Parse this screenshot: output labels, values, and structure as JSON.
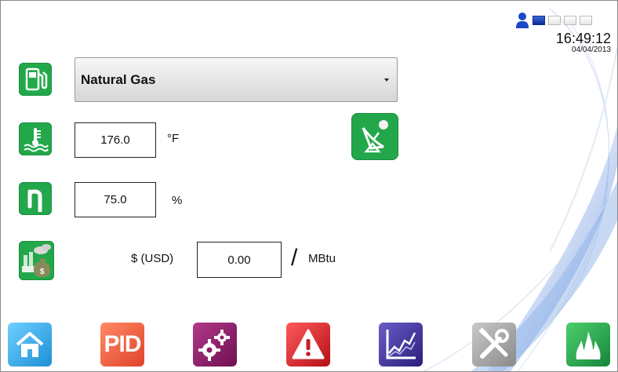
{
  "status": {
    "user_icon": "user-icon",
    "access_levels": [
      true,
      false,
      false,
      false
    ],
    "time": "16:49:12",
    "date": "04/04/2013"
  },
  "fuel": {
    "icon": "fuel-pump-icon",
    "selected": "Natural Gas"
  },
  "temperature": {
    "icon": "thermometer-water-icon",
    "value": "176.0",
    "unit": "°F"
  },
  "efficiency": {
    "icon": "eta-efficiency-icon",
    "value": "75.0",
    "unit": "%"
  },
  "cost": {
    "icon": "fuel-cost-icon",
    "currency_label": "$ (USD)",
    "value": "0.00",
    "separator": "/",
    "unit": "MBtu"
  },
  "remote_icon": "satellite-dish-icon",
  "nav": [
    {
      "icon": "home-icon",
      "color": "#29a3e0"
    },
    {
      "icon": "pid-icon",
      "label": "PID",
      "color": "#e8553a"
    },
    {
      "icon": "settings-gears-icon",
      "color": "#8e1a6a"
    },
    {
      "icon": "alarm-warning-icon",
      "color": "#c81e24"
    },
    {
      "icon": "trend-chart-icon",
      "color": "#3b2f8f"
    },
    {
      "icon": "tools-icon",
      "color": "#9a9a9a"
    },
    {
      "icon": "flame-icon",
      "color": "#22a84a"
    }
  ]
}
